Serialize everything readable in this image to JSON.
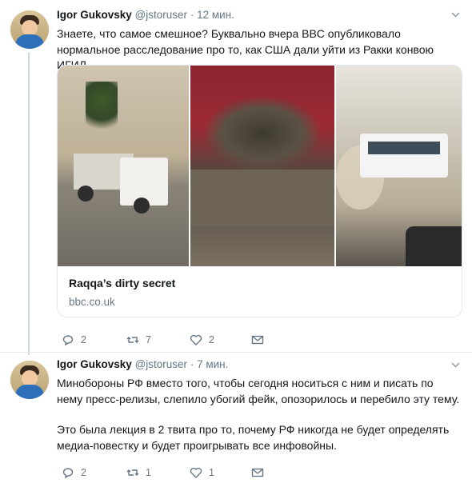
{
  "tweets": [
    {
      "name": "Igor Gukovsky",
      "handle": "@jstoruser",
      "sep": "·",
      "time": "12 мин.",
      "text": "Знаете, что самое смешное? Буквально вчера BBC опубликовало нормальное расследование про то, как США дали уйти из Ракки конвою ИГИЛ.",
      "card": {
        "title": "Raqqa’s dirty secret",
        "domain": "bbc.co.uk"
      },
      "counts": {
        "replies": "2",
        "retweets": "7",
        "likes": "2"
      }
    },
    {
      "name": "Igor Gukovsky",
      "handle": "@jstoruser",
      "sep": "·",
      "time": "7 мин.",
      "paragraphs": [
        "Минобороны РФ вместо того, чтобы сегодня носиться с ним и писать по нему пресс-релизы, слепило убогий фейк, опозорилось и перебило эту тему.",
        "Это была лекция в 2 твита про то, почему РФ никогда не будет определять медиа-повестку и будет проигрывать все инфовойны."
      ],
      "counts": {
        "replies": "2",
        "retweets": "1",
        "likes": "1"
      }
    }
  ],
  "icons": {
    "reply": "reply-icon",
    "retweet": "retweet-icon",
    "like": "heart-icon",
    "dm": "envelope-icon",
    "menu": "chevron-down-icon"
  },
  "colors": {
    "secondary": "#657786",
    "divider": "#e6ecf0",
    "thread": "#ccd6dd"
  }
}
